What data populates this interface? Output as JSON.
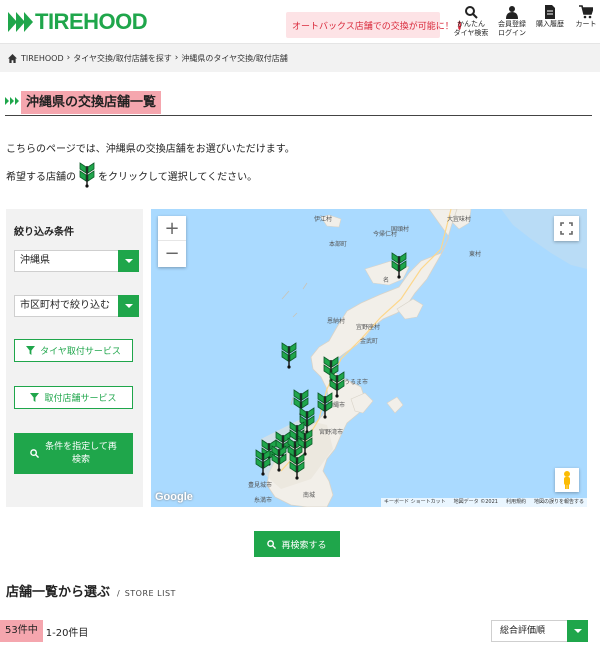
{
  "brand": {
    "logo_text": "TIREHOOD",
    "accent_color": "#1fa64b",
    "highlight_color": "#f5a6ae"
  },
  "header": {
    "promo_text": "オートバックス店舗での交換が可能に！",
    "nav": [
      {
        "label": "かんたん\nタイヤ検索",
        "icon": "search-icon"
      },
      {
        "label": "会員登録\nログイン",
        "icon": "user-icon"
      },
      {
        "label": "購入履歴",
        "icon": "document-icon"
      },
      {
        "label": "カート",
        "icon": "cart-icon"
      }
    ]
  },
  "breadcrumb": [
    "TIREHOOD",
    "タイヤ交換/取付店舗を探す",
    "沖縄県のタイヤ交換/取付店舗"
  ],
  "page_title": "沖縄県の交換店舗一覧",
  "intro": {
    "line1": "こちらのページでは、沖縄県の交換店舗をお選びいただけます。",
    "line2_before": "希望する店舗の",
    "line2_after": "をクリックして選択してください。"
  },
  "filter": {
    "title": "絞り込み条件",
    "prefecture": "沖縄県",
    "city_placeholder": "市区町村で絞り込む",
    "tire_service_label": "タイヤ取付サービス",
    "store_service_label": "取付店舗サービス",
    "search_button_label": "条件を指定して再\n検索"
  },
  "map": {
    "zoom_in": "+",
    "zoom_out": "−",
    "google_label": "Google",
    "attribution": [
      "キーボード ショートカット",
      "地図データ ©2021",
      "利用規約",
      "地図の誤りを報告する"
    ],
    "places": [
      "伊江村",
      "国頭村",
      "大宜味村",
      "東村",
      "本部町",
      "今帰仁村",
      "名",
      "宜野座村",
      "金武町",
      "恩納村",
      "うるま市",
      "宮野湾市",
      "沖縄市",
      "豊見城市",
      "糸満市",
      "南城"
    ]
  },
  "re_search_label": "再検索する",
  "store_list": {
    "heading": "店舗一覧から選ぶ",
    "subheading": "STORE LIST"
  },
  "results": {
    "count_label": "53件中",
    "range_label": "1-20件目"
  },
  "sort": {
    "selected": "総合評価順"
  }
}
